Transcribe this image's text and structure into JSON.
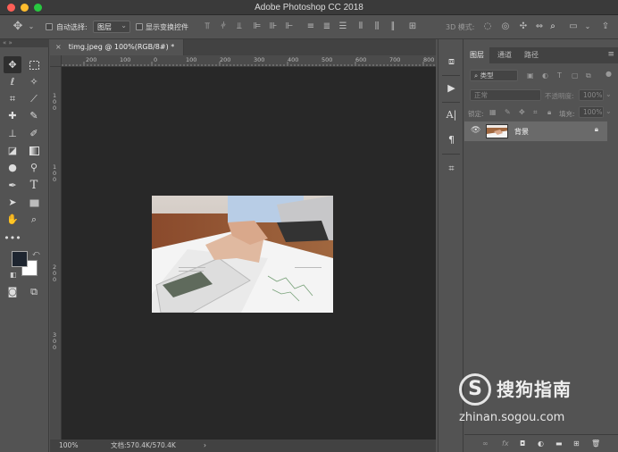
{
  "window": {
    "title": "Adobe Photoshop CC 2018"
  },
  "options_bar": {
    "auto_select_label": "自动选择:",
    "auto_select_value": "图层",
    "show_transform_label": "显示变换控件",
    "mode_3d_label": "3D 模式:"
  },
  "collapse": {
    "left": "« »",
    "right": "« »"
  },
  "document": {
    "tab_label": "timg.jpeg @ 100%(RGB/8#) *",
    "ruler_h": [
      "200",
      "100",
      "0",
      "100",
      "200",
      "300",
      "400",
      "500",
      "600",
      "700",
      "800"
    ],
    "ruler_v": [
      "1",
      "0",
      "0",
      "1",
      "0",
      "0",
      "2",
      "0",
      "0",
      "3",
      "0",
      "0"
    ],
    "zoom": "100%",
    "doc_info": "文档:570.4K/570.4K"
  },
  "layers_panel": {
    "tabs": [
      "图层",
      "通道",
      "路径"
    ],
    "filter_kind": "类型",
    "blend_mode": "正常",
    "opacity_label": "不透明度:",
    "opacity_value": "100%",
    "lock_label": "锁定:",
    "fill_label": "填充:",
    "fill_value": "100%",
    "layers": [
      {
        "name": "背景"
      }
    ]
  },
  "watermark": {
    "brand": "搜狗指南",
    "url": "zhinan.sogou.com"
  },
  "colors": {
    "accent_red": "#fe5f57",
    "accent_yellow": "#febc2e",
    "accent_green": "#28c840",
    "canvas_bg": "#282828"
  }
}
